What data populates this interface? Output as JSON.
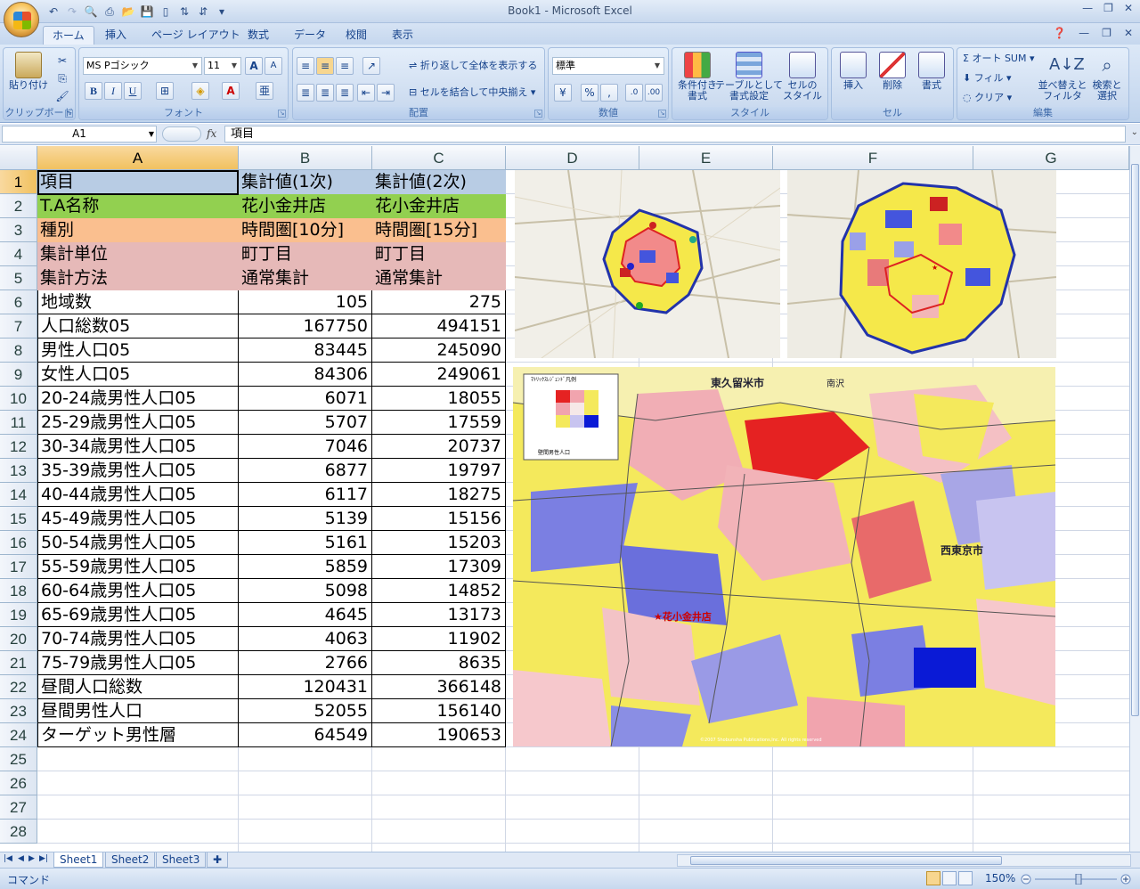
{
  "window": {
    "title": "Book1 - Microsoft Excel"
  },
  "tabs": [
    "ホーム",
    "挿入",
    "ページ レイアウト",
    "数式",
    "データ",
    "校閲",
    "表示"
  ],
  "ribbon": {
    "clipboard": {
      "paste": "貼り付け",
      "label": "クリップボード"
    },
    "font": {
      "name": "MS Pゴシック",
      "size": "11",
      "label": "フォント"
    },
    "alignment": {
      "wrap": "折り返して全体を表示する",
      "merge": "セルを結合して中央揃え",
      "label": "配置"
    },
    "number": {
      "format": "標準",
      "label": "数値"
    },
    "styles": {
      "conditional": "条件付き\n書式",
      "table": "テーブルとして\n書式設定",
      "cell": "セルの\nスタイル",
      "label": "スタイル"
    },
    "cells": {
      "insert": "挿入",
      "delete": "削除",
      "format": "書式",
      "label": "セル"
    },
    "editing": {
      "autosum": "オート SUM",
      "fill": "フィル",
      "clear": "クリア",
      "sort": "並べ替えと\nフィルタ",
      "find": "検索と\n選択",
      "label": "編集"
    }
  },
  "formula_bar": {
    "name_box": "A1",
    "fx": "fx",
    "content": "項目"
  },
  "columns": [
    "A",
    "B",
    "C",
    "D",
    "E",
    "F",
    "G"
  ],
  "rows": [
    "1",
    "2",
    "3",
    "4",
    "5",
    "6",
    "7",
    "8",
    "9",
    "10",
    "11",
    "12",
    "13",
    "14",
    "15",
    "16",
    "17",
    "18",
    "19",
    "20",
    "21",
    "22",
    "23",
    "24",
    "25",
    "26",
    "27",
    "28"
  ],
  "cells": [
    [
      "項目",
      "集計値(1次)",
      "集計値(2次)"
    ],
    [
      "T.A名称",
      "花小金井店",
      "花小金井店"
    ],
    [
      "種別",
      "時間圏[10分]",
      "時間圏[15分]"
    ],
    [
      "集計単位",
      "町丁目",
      "町丁目"
    ],
    [
      "集計方法",
      "通常集計",
      "通常集計"
    ],
    [
      "地域数",
      "105",
      "275"
    ],
    [
      "人口総数05",
      "167750",
      "494151"
    ],
    [
      "男性人口05",
      "83445",
      "245090"
    ],
    [
      "女性人口05",
      "84306",
      "249061"
    ],
    [
      "20-24歳男性人口05",
      "6071",
      "18055"
    ],
    [
      "25-29歳男性人口05",
      "5707",
      "17559"
    ],
    [
      "30-34歳男性人口05",
      "7046",
      "20737"
    ],
    [
      "35-39歳男性人口05",
      "6877",
      "19797"
    ],
    [
      "40-44歳男性人口05",
      "6117",
      "18275"
    ],
    [
      "45-49歳男性人口05",
      "5139",
      "15156"
    ],
    [
      "50-54歳男性人口05",
      "5161",
      "15203"
    ],
    [
      "55-59歳男性人口05",
      "5859",
      "17309"
    ],
    [
      "60-64歳男性人口05",
      "5098",
      "14852"
    ],
    [
      "65-69歳男性人口05",
      "4645",
      "13173"
    ],
    [
      "70-74歳男性人口05",
      "4063",
      "11902"
    ],
    [
      "75-79歳男性人口05",
      "2766",
      "8635"
    ],
    [
      "昼間人口総数",
      "120431",
      "366148"
    ],
    [
      "昼間男性人口",
      "52055",
      "156140"
    ],
    [
      "ターゲット男性層",
      "64549",
      "190653"
    ]
  ],
  "row_colors": [
    "#b8cce4",
    "#92d050",
    "#fabf8f",
    "#e6b9b8",
    "#e6b9b8"
  ],
  "map_labels": {
    "store": "★花小金井店",
    "city1": "東久留米市",
    "city2": "西東京市",
    "area1": "南沢",
    "legend_title": "ﾏﾄﾘｯｸｽﾚｼﾞｪﾝﾄﾞ凡例\n【花小金井店】",
    "legend_x": "壁間男性人口",
    "copyright": "©2007 Shobunsha Publications,Inc. All rights reserved"
  },
  "sheets": [
    "Sheet1",
    "Sheet2",
    "Sheet3"
  ],
  "status": {
    "mode": "コマンド",
    "zoom": "150%"
  }
}
